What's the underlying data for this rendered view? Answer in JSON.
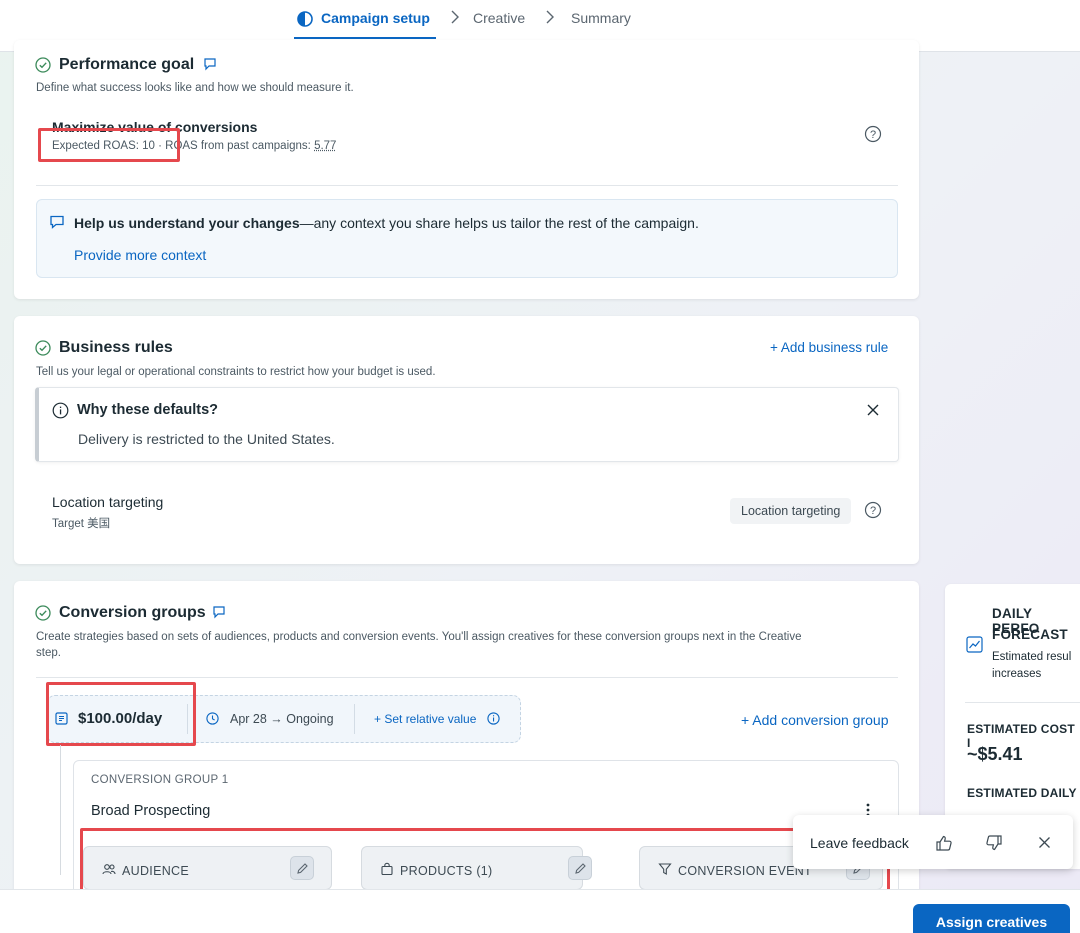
{
  "steps": [
    {
      "label": "Campaign setup",
      "active": true
    },
    {
      "label": "Creative",
      "active": false
    },
    {
      "label": "Summary",
      "active": false
    }
  ],
  "performance_goal": {
    "title": "Performance goal",
    "description": "Define what success looks like and how we should measure it.",
    "goal_name": "Maximize value of conversions",
    "goal_detail_prefix": "Expected ROAS: 10 · ROAS from past campaigns: ",
    "past_roas": "5.77",
    "help_bold": "Help us understand your changes",
    "help_text": "—any context you share helps us tailor the rest of the campaign.",
    "help_link": "Provide more context"
  },
  "business_rules": {
    "title": "Business rules",
    "add_rule": "+ Add business rule",
    "description": "Tell us your legal or operational constraints to restrict how your budget is used.",
    "defaults_title": "Why these defaults?",
    "defaults_text": "Delivery is restricted to the United States.",
    "location_title": "Location targeting",
    "location_value": "Target 美国",
    "location_chip": "Location targeting"
  },
  "conversion_groups": {
    "title": "Conversion groups",
    "description_line1": "Create strategies based on sets of audiences, products and conversion events. You'll assign creatives for these conversion groups next in the Creative",
    "description_line2": "step.",
    "budget": "$100.00/day",
    "date_range": "Apr 28 → Ongoing",
    "set_relative": "+ Set relative value",
    "add_group": "+ Add conversion group",
    "group_label": "CONVERSION GROUP 1",
    "group_name": "Broad Prospecting",
    "tiles": [
      "AUDIENCE",
      "PRODUCTS (1)",
      "CONVERSION EVENT"
    ]
  },
  "forecast": {
    "title_line1": "DAILY PERFO",
    "title_line2": "FORECAST",
    "subtitle_line1": "Estimated resul",
    "subtitle_line2": "increases",
    "cost_label": "ESTIMATED COST I",
    "cost_value": "~$5.41",
    "daily_label": "ESTIMATED DAILY"
  },
  "feedback": {
    "label": "Leave feedback"
  },
  "actions": {
    "assign": "Assign creatives"
  },
  "colors": {
    "accent": "#0a66c2",
    "highlight": "#e5484d",
    "success": "#3b8a5a"
  }
}
